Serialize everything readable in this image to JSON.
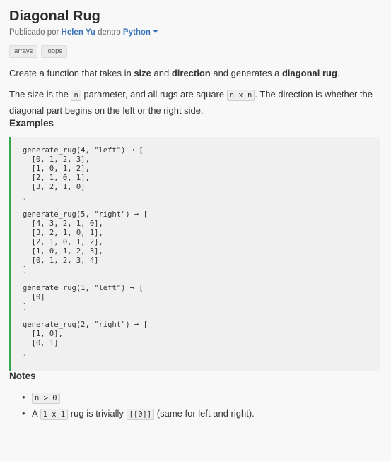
{
  "challenge": {
    "title": "Diagonal Rug",
    "byline": {
      "published_by": "Publicado por",
      "author": "Helen Yu",
      "within": "dentro",
      "language": "Python"
    },
    "tags": [
      "arrays",
      "loops"
    ]
  },
  "description": {
    "p1": {
      "t1": "Create a function that takes in ",
      "b1": "size",
      "t2": " and ",
      "b2": "direction",
      "t3": " and generates a ",
      "b3": "diagonal rug",
      "t4": "."
    },
    "p2": {
      "t1": "The size is the ",
      "c1": "n",
      "t2": " parameter, and all rugs are square ",
      "c2": "n x n",
      "t3": ". The direction is whether the diagonal part begins on the left or the right side."
    }
  },
  "examples": {
    "heading": "Examples",
    "code": "generate_rug(4, \"left\") ➞ [\n  [0, 1, 2, 3],\n  [1, 0, 1, 2],\n  [2, 1, 0, 1],\n  [3, 2, 1, 0]\n]\n\ngenerate_rug(5, \"right\") ➞ [\n  [4, 3, 2, 1, 0],\n  [3, 2, 1, 0, 1],\n  [2, 1, 0, 1, 2],\n  [1, 0, 1, 2, 3],\n  [0, 1, 2, 3, 4]\n]\n\ngenerate_rug(1, \"left\") ➞ [\n  [0]\n]\n\ngenerate_rug(2, \"right\") ➞ [\n  [1, 0],\n  [0, 1]\n]"
  },
  "notes": {
    "heading": "Notes",
    "bullet": "•",
    "item1": {
      "c1": "n > 0"
    },
    "item2": {
      "t1": "A ",
      "c1": "1 x 1",
      "t2": " rug is trivially ",
      "c2": "[[0]]",
      "t3": " (same for left and right)."
    }
  },
  "colors": {
    "link": "#3a72b8",
    "code_accent": "#36a84f",
    "background": "#f8f8f8"
  }
}
